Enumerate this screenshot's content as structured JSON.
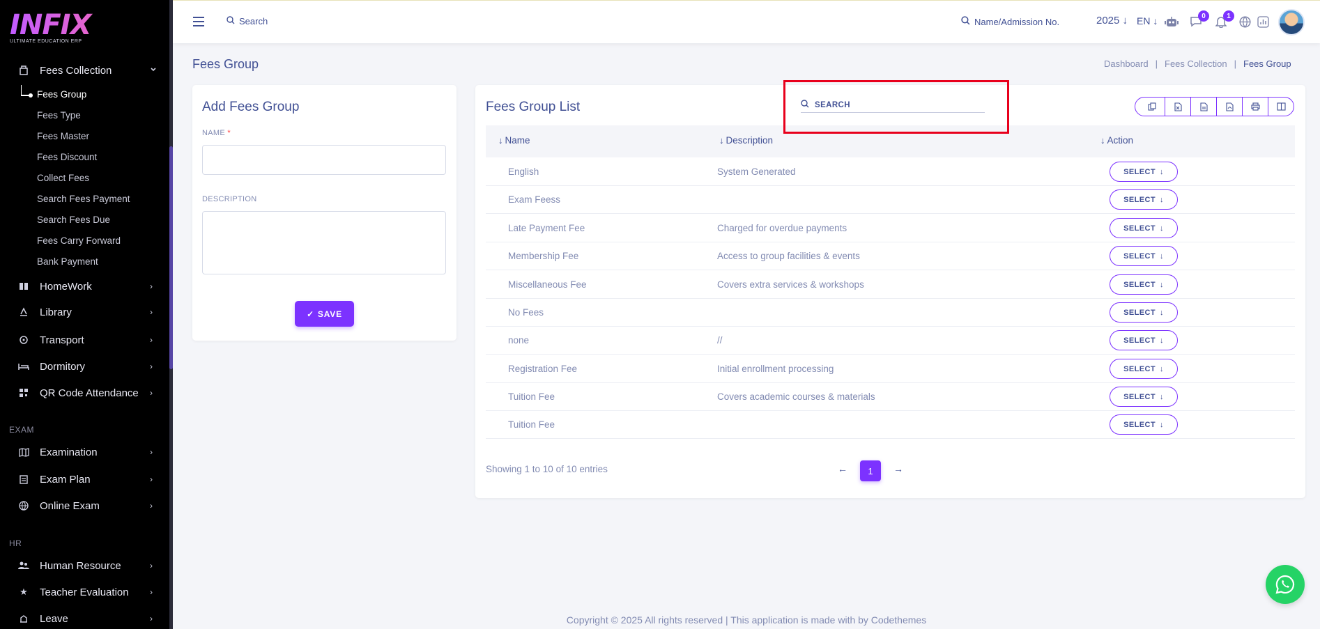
{
  "brand": {
    "logo": "INFIX",
    "tagline": "ULTIMATE EDUCATION ERP"
  },
  "sidebar": {
    "fees_collection": {
      "label": "Fees Collection",
      "icon": "fees-icon"
    },
    "fees_sub": [
      {
        "label": "Fees Group",
        "active": true
      },
      {
        "label": "Fees Type"
      },
      {
        "label": "Fees Master"
      },
      {
        "label": "Fees Discount"
      },
      {
        "label": "Collect Fees"
      },
      {
        "label": "Search Fees Payment"
      },
      {
        "label": "Search Fees Due"
      },
      {
        "label": "Fees Carry Forward"
      },
      {
        "label": "Bank Payment"
      }
    ],
    "items": [
      {
        "label": "HomeWork",
        "icon": "book-icon"
      },
      {
        "label": "Library",
        "icon": "library-icon"
      },
      {
        "label": "Transport",
        "icon": "transport-icon"
      },
      {
        "label": "Dormitory",
        "icon": "bed-icon"
      },
      {
        "label": "QR Code Attendance",
        "icon": "qr-icon"
      }
    ],
    "exam_section": "EXAM",
    "exam_items": [
      {
        "label": "Examination",
        "icon": "map-icon"
      },
      {
        "label": "Exam Plan",
        "icon": "clipboard-icon"
      },
      {
        "label": "Online Exam",
        "icon": "globe-icon"
      }
    ],
    "hr_section": "HR",
    "hr_items": [
      {
        "label": "Human Resource",
        "icon": "people-icon"
      },
      {
        "label": "Teacher Evaluation",
        "icon": "star-icon"
      },
      {
        "label": "Leave",
        "icon": "leave-icon"
      }
    ]
  },
  "topbar": {
    "search_placeholder": "Search",
    "admission_search": "Name/Admission No.",
    "year": "2025",
    "lang": "EN",
    "messages_count": "0",
    "notifications_count": "1"
  },
  "page": {
    "title": "Fees Group",
    "breadcrumb": [
      "Dashboard",
      "Fees Collection",
      "Fees Group"
    ]
  },
  "form": {
    "title": "Add Fees Group",
    "name_label": "NAME",
    "required_mark": "*",
    "description_label": "DESCRIPTION",
    "save_label": "SAVE"
  },
  "list": {
    "title": "Fees Group List",
    "search_placeholder": "SEARCH",
    "columns": [
      "Name",
      "Description",
      "Action"
    ],
    "action_label": "SELECT",
    "rows": [
      {
        "name": "English",
        "description": "System Generated"
      },
      {
        "name": "Exam Feess",
        "description": ""
      },
      {
        "name": "Late Payment Fee",
        "description": "Charged for overdue payments"
      },
      {
        "name": "Membership Fee",
        "description": "Access to group facilities & events"
      },
      {
        "name": "Miscellaneous Fee",
        "description": "Covers extra services & workshops"
      },
      {
        "name": "No Fees",
        "description": ""
      },
      {
        "name": "none",
        "description": "//"
      },
      {
        "name": "Registration Fee",
        "description": "Initial enrollment processing"
      },
      {
        "name": "Tuition Fee",
        "description": "Covers academic courses & materials"
      },
      {
        "name": "Tuition Fee",
        "description": ""
      }
    ],
    "showing": "Showing 1 to 10 of 10 entries",
    "current_page": "1"
  },
  "footer": "Copyright © 2025 All rights reserved | This application is made with by Codethemes",
  "colors": {
    "accent": "#7c32ff",
    "text": "#415094",
    "muted": "#828bb2",
    "highlight": "#e8001c",
    "whatsapp": "#25d366"
  }
}
